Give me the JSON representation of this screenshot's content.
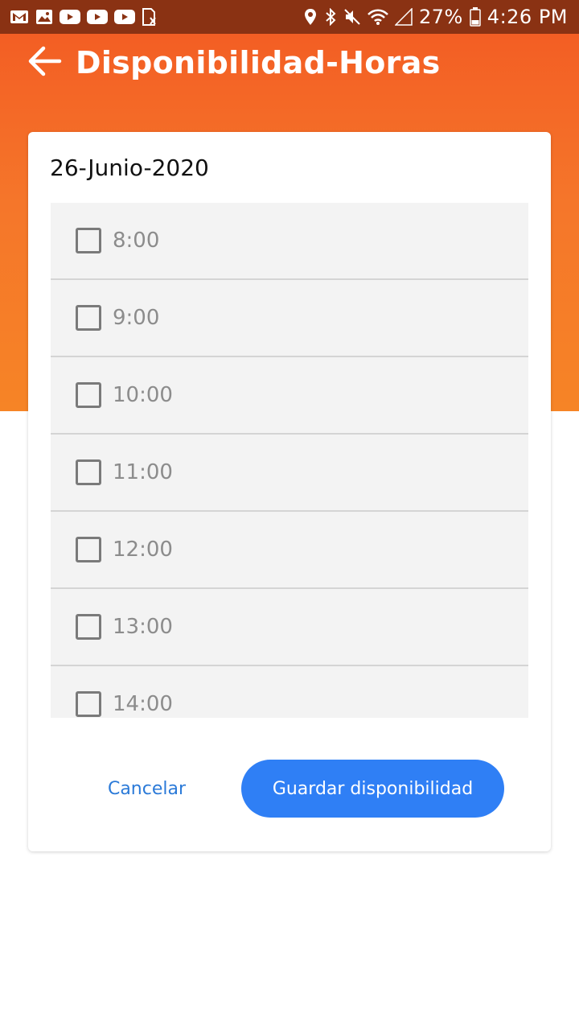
{
  "status_bar": {
    "left_icons": [
      "gmail-icon",
      "gallery-icon",
      "youtube-icon",
      "youtube-icon",
      "youtube-icon",
      "sim-error-icon"
    ],
    "right_icons": [
      "location-icon",
      "bluetooth-icon",
      "mute-icon",
      "wifi-icon",
      "signal-icon",
      "battery-icon"
    ],
    "battery": "27%",
    "time": "4:26 PM"
  },
  "header": {
    "back_icon": "arrow-left-icon",
    "title": "Disponibilidad-Horas"
  },
  "card": {
    "date": "26-Junio-2020",
    "slots": [
      {
        "label": "8:00",
        "checked": false
      },
      {
        "label": "9:00",
        "checked": false
      },
      {
        "label": "10:00",
        "checked": false
      },
      {
        "label": "11:00",
        "checked": false
      },
      {
        "label": "12:00",
        "checked": false
      },
      {
        "label": "13:00",
        "checked": false
      },
      {
        "label": "14:00",
        "checked": false
      }
    ],
    "cancel_label": "Cancelar",
    "save_label": "Guardar disponibilidad"
  },
  "colors": {
    "status_bar": "#8a3213",
    "header_orange": "#f35e24",
    "primary_button": "#2f7ff5",
    "link_blue": "#2b7ad8"
  }
}
